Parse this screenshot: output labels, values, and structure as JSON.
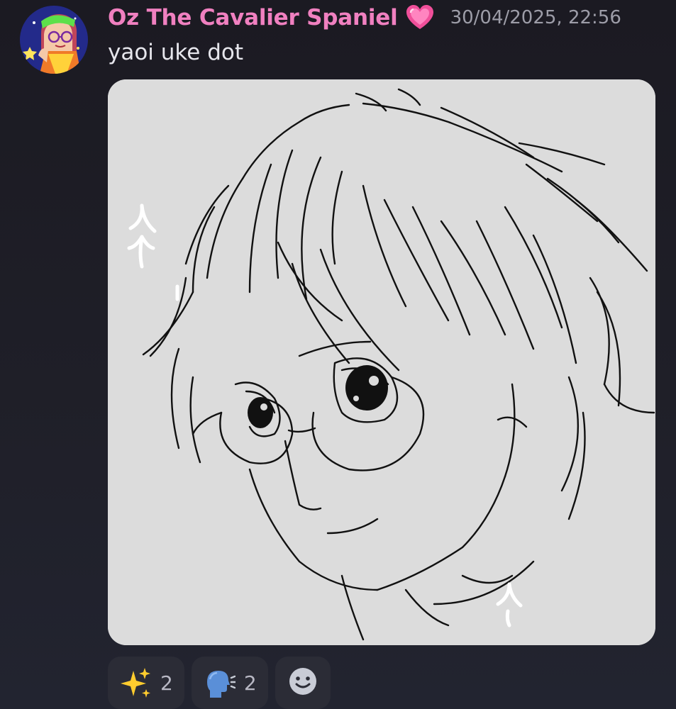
{
  "message": {
    "author": "Oz The Cavalier Spaniel",
    "author_color": "#f080c0",
    "author_badge_icon": "pink-heart-icon",
    "timestamp": "30/04/2025, 22:56",
    "text": "yaoi uke dot",
    "attachment": {
      "type": "image",
      "description_icon": "sketch-drawing"
    }
  },
  "reactions": [
    {
      "emoji": "sparkles-icon",
      "count": "2"
    },
    {
      "emoji": "speaking-head-icon",
      "count": "2"
    }
  ],
  "add_reaction_icon": "smiley-add-reaction-icon",
  "colors": {
    "background": "#1e1e26",
    "reaction_bg": "#2b2c36",
    "timestamp": "#9d9da8",
    "text": "#e6e6ec"
  }
}
